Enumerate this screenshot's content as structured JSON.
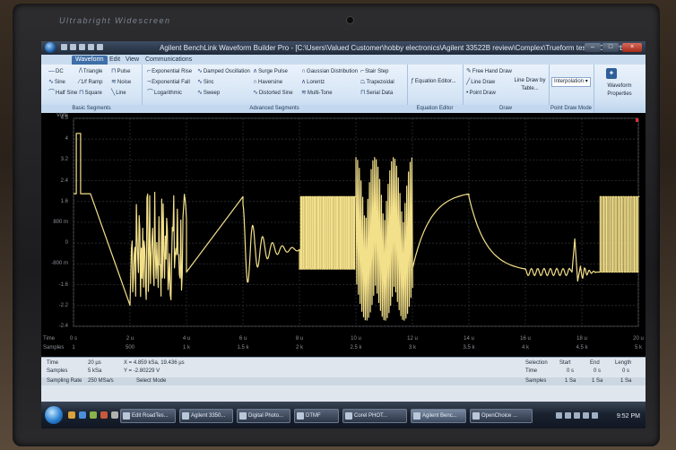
{
  "laptop": {
    "brand": "Ultrabright Widescreen"
  },
  "window": {
    "title": "Agilent BenchLink Waveform Builder Pro - [C:\\Users\\Valued Customer\\hobby electronics\\Agilent 33522B review\\Complex\\Trueform test 5 20us.arb]",
    "controls": {
      "minimize": "–",
      "maximize": "□",
      "close": "×"
    }
  },
  "tabs": [
    "Waveform",
    "Edit",
    "View",
    "Communications"
  ],
  "ribbon": {
    "basic": {
      "label": "Basic Segments",
      "items": [
        "DC",
        "Triangle",
        "Pulse",
        "Sine",
        "1/f Ramp",
        "Noise",
        "Half Sine",
        "Square",
        "Line"
      ]
    },
    "advanced": {
      "label": "Advanced Segments",
      "items": [
        "Exponential Rise",
        "Damped Oscillation",
        "Surge Pulse",
        "Gaussian Distribution",
        "Stair Step",
        "Exponential Fall",
        "Sinc",
        "Haversine",
        "Lorentz",
        "Trapezoidal",
        "Logarithmic",
        "Sweep",
        "Distorted Sine",
        "Multi-Tone",
        "Serial Data"
      ]
    },
    "equation": {
      "label": "Equation Editor",
      "item": "Equation Editor..."
    },
    "draw": {
      "label": "Draw",
      "items": [
        "Free Hand Draw",
        "Line Draw",
        "Point Draw",
        "Line Draw by Table..."
      ]
    },
    "pointdraw": {
      "label": "Point Draw Mode",
      "item": "Interpolation"
    },
    "props": {
      "item": "Waveform Properties"
    }
  },
  "plot": {
    "y_unit": "Volts",
    "y_ticks": [
      "4.5",
      "4",
      "3.2",
      "2.4",
      "1.6",
      "800 m",
      "0",
      "-800 m",
      "-1.6",
      "-2.2",
      "-2.4"
    ],
    "time_label": "Time",
    "samples_label": "Samples",
    "x_time_ticks": [
      "0 s",
      "2 u",
      "4 u",
      "6 u",
      "8 u",
      "10 u",
      "12 u",
      "14 u",
      "16 u",
      "18 u",
      "20 u"
    ],
    "x_sample_ticks": [
      "1",
      "500",
      "1 k",
      "1.5 k",
      "2 k",
      "2.5 k",
      "3 k",
      "3.5 k",
      "4 k",
      "4.5 k",
      "5 k"
    ],
    "trace_color": "#f3e08a"
  },
  "status": {
    "time_label": "Time",
    "time_value": "20 µs",
    "samples_label": "Samples",
    "samples_value": "5 kSa",
    "rate_label": "Sampling Rate",
    "rate_value": "250 MSa/s",
    "cursor_x": "X = 4.859 kSa, 19.436 µs",
    "cursor_y": "Y = -2.80229 V",
    "mode": "Select Mode",
    "selection_label": "Selection",
    "sel_headers": [
      "Start",
      "End",
      "Length"
    ],
    "sel_time": [
      "0 s",
      "0 s",
      "0 s"
    ],
    "sel_samples": [
      "1 Sa",
      "1 Sa",
      "1 Sa"
    ]
  },
  "taskbar": {
    "tasks": [
      "Edit RoadTes...",
      "Agilent 3350...",
      "Digital Photo...",
      "DTMF",
      "Corel PHOT...",
      "Agilent Benc...",
      "OpenChoice ..."
    ],
    "active_index": 5,
    "clock": "9:52 PM"
  }
}
